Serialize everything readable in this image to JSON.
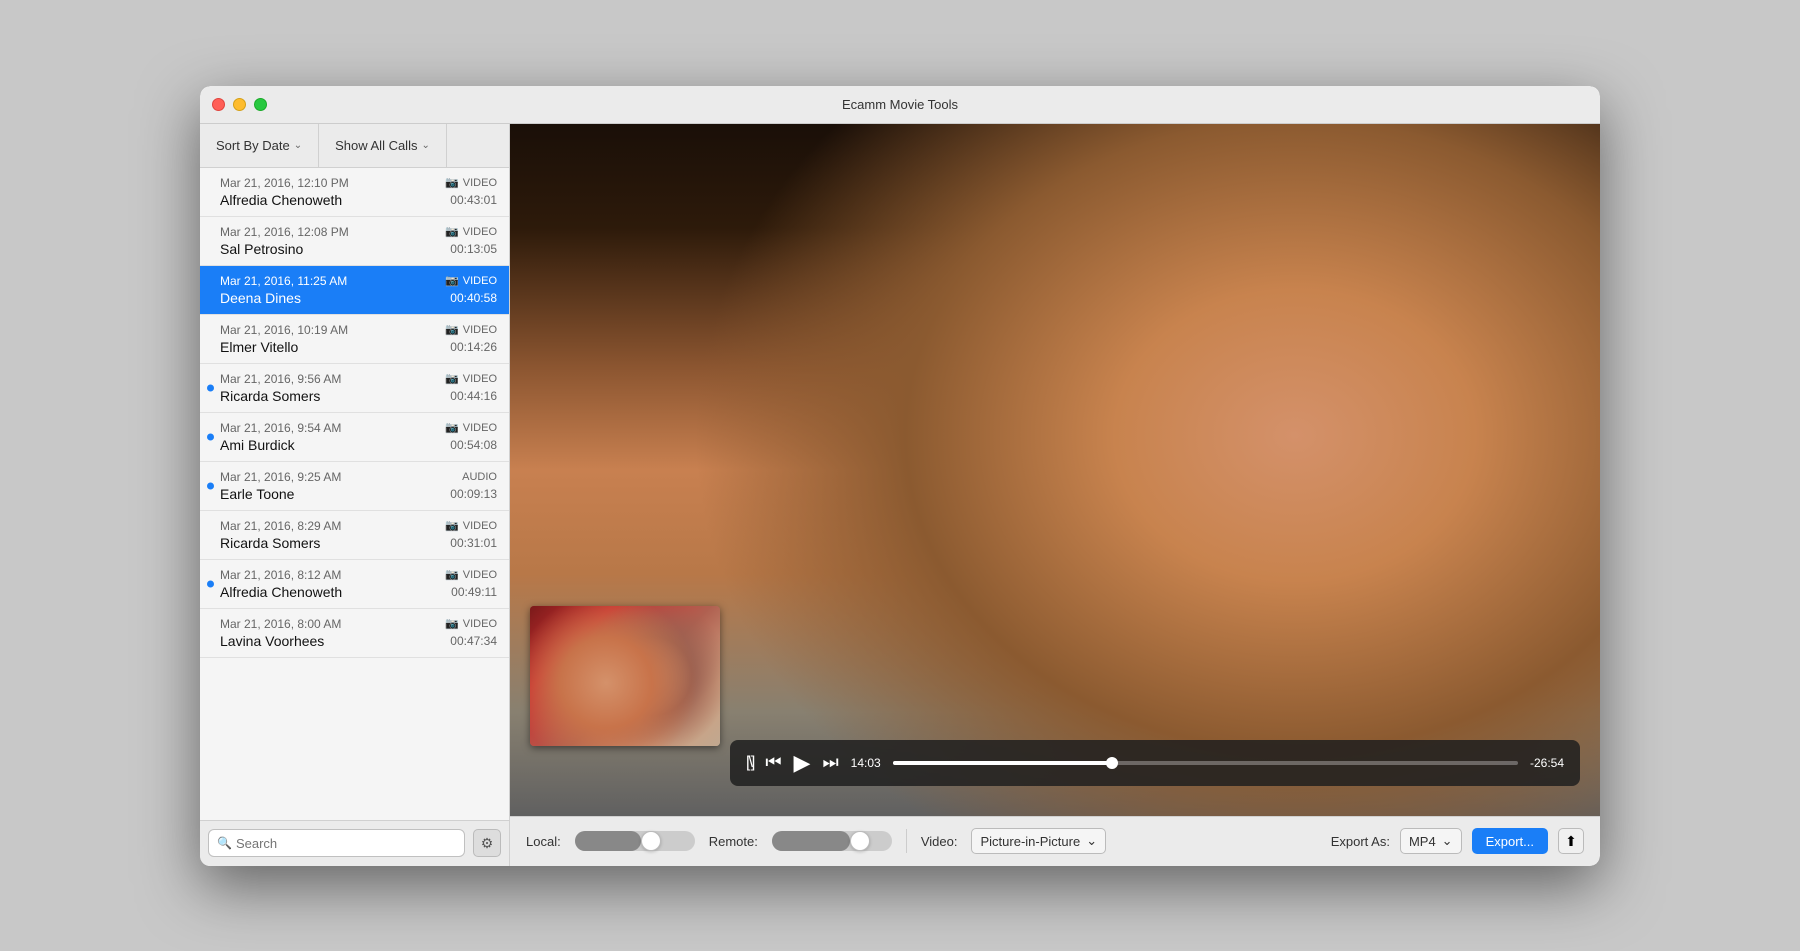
{
  "window": {
    "title": "Ecamm Movie Tools"
  },
  "sidebar": {
    "sort_btn": "Sort By Date",
    "filter_btn": "Show All Calls",
    "search_placeholder": "Search"
  },
  "calls": [
    {
      "id": 1,
      "date": "Mar 21, 2016, 12:10 PM",
      "name": "Alfredia Chenoweth",
      "type": "VIDEO",
      "duration": "00:43:01",
      "selected": false,
      "unread": false,
      "has_video_icon": true
    },
    {
      "id": 2,
      "date": "Mar 21, 2016, 12:08 PM",
      "name": "Sal Petrosino",
      "type": "VIDEO",
      "duration": "00:13:05",
      "selected": false,
      "unread": false,
      "has_video_icon": true
    },
    {
      "id": 3,
      "date": "Mar 21, 2016, 11:25 AM",
      "name": "Deena Dines",
      "type": "VIDEO",
      "duration": "00:40:58",
      "selected": true,
      "unread": false,
      "has_video_icon": true
    },
    {
      "id": 4,
      "date": "Mar 21, 2016, 10:19 AM",
      "name": "Elmer Vitello",
      "type": "VIDEO",
      "duration": "00:14:26",
      "selected": false,
      "unread": false,
      "has_video_icon": true
    },
    {
      "id": 5,
      "date": "Mar 21, 2016, 9:56 AM",
      "name": "Ricarda Somers",
      "type": "VIDEO",
      "duration": "00:44:16",
      "selected": false,
      "unread": true,
      "has_video_icon": true
    },
    {
      "id": 6,
      "date": "Mar 21, 2016, 9:54 AM",
      "name": "Ami Burdick",
      "type": "VIDEO",
      "duration": "00:54:08",
      "selected": false,
      "unread": true,
      "has_video_icon": true
    },
    {
      "id": 7,
      "date": "Mar 21, 2016, 9:25 AM",
      "name": "Earle Toone",
      "type": "AUDIO",
      "duration": "00:09:13",
      "selected": false,
      "unread": true,
      "has_video_icon": false
    },
    {
      "id": 8,
      "date": "Mar 21, 2016, 8:29 AM",
      "name": "Ricarda Somers",
      "type": "VIDEO",
      "duration": "00:31:01",
      "selected": false,
      "unread": false,
      "has_video_icon": true
    },
    {
      "id": 9,
      "date": "Mar 21, 2016, 8:12 AM",
      "name": "Alfredia Chenoweth",
      "type": "VIDEO",
      "duration": "00:49:11",
      "selected": false,
      "unread": true,
      "has_video_icon": true
    },
    {
      "id": 10,
      "date": "Mar 21, 2016, 8:00 AM",
      "name": "Lavina Voorhees",
      "type": "VIDEO",
      "duration": "00:47:34",
      "selected": false,
      "unread": false,
      "has_video_icon": true
    }
  ],
  "transport": {
    "current_time": "14:03",
    "remaining_time": "-26:54",
    "progress_percent": 35
  },
  "bottom_toolbar": {
    "local_label": "Local:",
    "remote_label": "Remote:",
    "video_label": "Video:",
    "video_mode": "Picture-in-Picture",
    "export_label": "Export As:",
    "export_format": "MP4",
    "export_btn": "Export...",
    "gear_icon": "⚙"
  }
}
